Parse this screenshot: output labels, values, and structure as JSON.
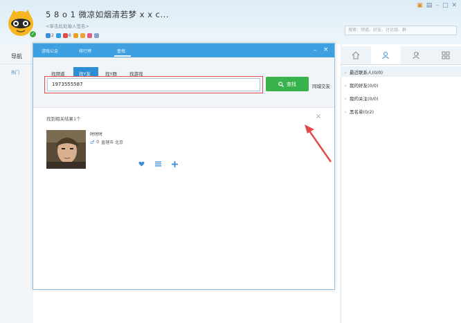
{
  "profile": {
    "nickname": "5 8 o 1  微凉如烟清若梦 x x c...",
    "signature": "<单击此处输入签名>",
    "status": [
      {
        "icon": "vip-icon",
        "value": "2",
        "color": "#3a8fd8"
      },
      {
        "icon": "diamond-icon",
        "value": "",
        "color": "#2aa0e8"
      },
      {
        "icon": "level-icon",
        "value": "6",
        "color": "#e34a4a"
      },
      {
        "icon": "medal-icon",
        "value": "",
        "color": "#e8a020"
      },
      {
        "icon": "game-icon",
        "value": "",
        "color": "#f0a030"
      },
      {
        "icon": "heart-icon",
        "value": "",
        "color": "#e05a8a"
      },
      {
        "icon": "globe-icon",
        "value": "",
        "color": "#8aa0c8"
      }
    ]
  },
  "header_search": {
    "placeholder": "搜索：频道、好友、讨论组、群"
  },
  "left_nav": {
    "title": "导航",
    "sub": "热门"
  },
  "right_panel": {
    "tabs": [
      {
        "icon": "home-icon"
      },
      {
        "icon": "user-icon"
      },
      {
        "icon": "group-icon"
      },
      {
        "icon": "apps-icon"
      }
    ],
    "groups": [
      {
        "label": "最近联系人(0/0)"
      },
      {
        "label": "我的好友(0/0)"
      },
      {
        "label": "我的关注(0/0)"
      },
      {
        "label": "黑名单(0/2)"
      }
    ]
  },
  "dialog": {
    "tabs": [
      {
        "label": "游戏公会"
      },
      {
        "label": "排行榜"
      },
      {
        "label": "查找"
      }
    ],
    "search_tabs": [
      {
        "label": "找频道"
      },
      {
        "label": "找Y友"
      },
      {
        "label": "找Y群"
      },
      {
        "label": "找游戏"
      }
    ],
    "query": "1973555587",
    "search_button": "查找",
    "city_friends": "同城交友",
    "result_count": "找到相关结果1个",
    "result": {
      "name": "时时时",
      "age": "0",
      "location": "直辖市  北京"
    }
  },
  "colors": {
    "titlebar": "#3ea0e0",
    "search_button": "#38b24a",
    "highlight": "#e34a4a"
  }
}
